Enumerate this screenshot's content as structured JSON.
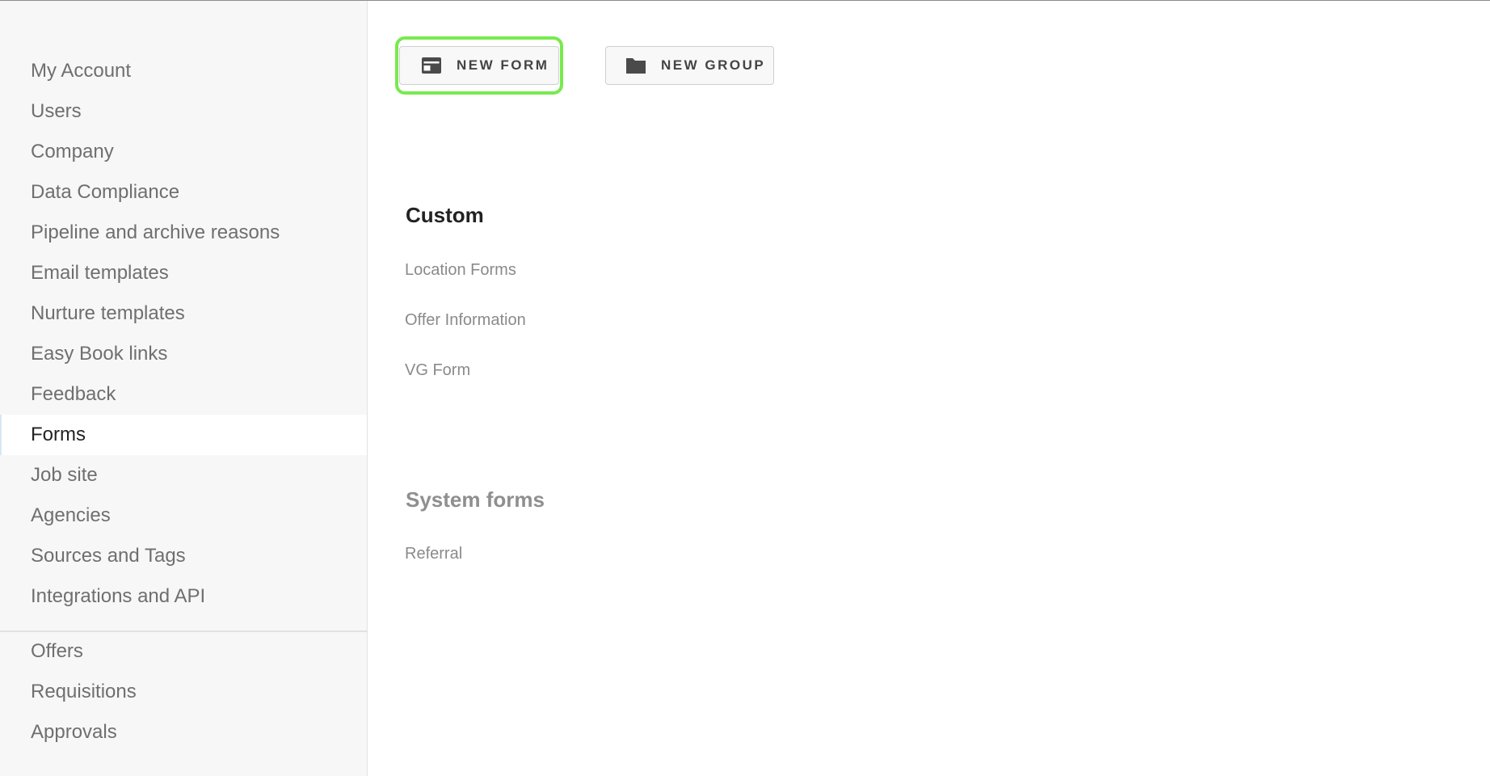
{
  "sidebar": {
    "primary_items": [
      {
        "label": "My Account"
      },
      {
        "label": "Users"
      },
      {
        "label": "Company"
      },
      {
        "label": "Data Compliance"
      },
      {
        "label": "Pipeline and archive reasons"
      },
      {
        "label": "Email templates"
      },
      {
        "label": "Nurture templates"
      },
      {
        "label": "Easy Book links"
      },
      {
        "label": "Feedback"
      },
      {
        "label": "Forms",
        "active": true
      },
      {
        "label": "Job site"
      },
      {
        "label": "Agencies"
      },
      {
        "label": "Sources and Tags"
      },
      {
        "label": "Integrations and API"
      }
    ],
    "secondary_items": [
      {
        "label": "Offers"
      },
      {
        "label": "Requisitions"
      },
      {
        "label": "Approvals"
      }
    ]
  },
  "toolbar": {
    "new_form_label": "NEW FORM",
    "new_form_icon": "form-card-icon",
    "new_group_label": "NEW GROUP",
    "new_group_icon": "folder-icon",
    "focus_color": "#78ea4e"
  },
  "custom_section": {
    "title": "Custom",
    "forms": [
      "Location Forms",
      "Offer Information",
      "VG Form"
    ]
  },
  "system_section": {
    "title": "System forms",
    "forms": [
      "Referral"
    ]
  }
}
